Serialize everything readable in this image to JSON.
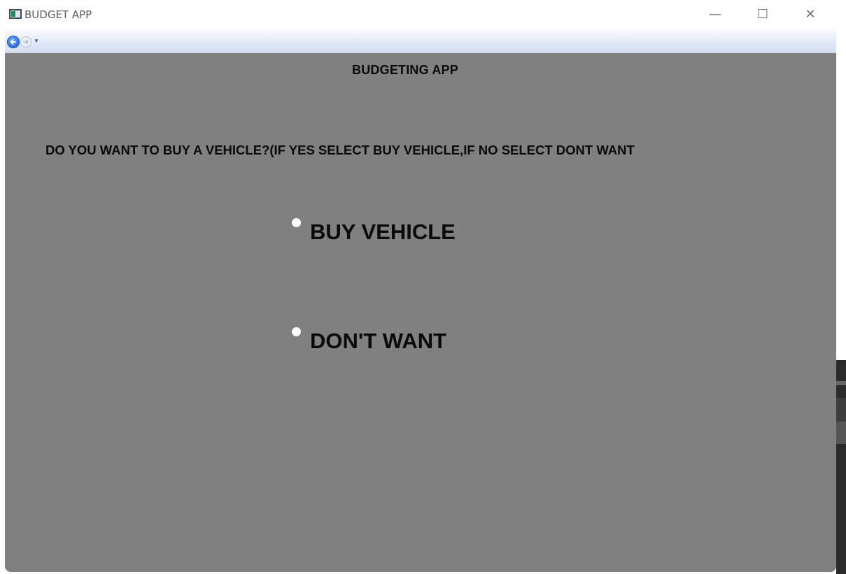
{
  "window": {
    "title": "BUDGET APP",
    "controls": {
      "minimize": "—",
      "maximize": "☐",
      "close": "✕"
    }
  },
  "nav": {
    "back_icon": "back-arrow-icon",
    "forward_icon": "forward-arrow-icon",
    "history_icon": "chevron-down-icon"
  },
  "page": {
    "heading": "BUDGETING APP",
    "question": "DO YOU WANT TO BUY A VEHICLE?(IF YES SELECT BUY VEHICLE,IF NO SELECT DONT WANT",
    "options": [
      {
        "label": "BUY VEHICLE",
        "selected": false
      },
      {
        "label": "DON'T WANT",
        "selected": false
      }
    ]
  },
  "colors": {
    "content_background": "#808080",
    "text": "#0a0a0a",
    "radio": "#ffffff"
  }
}
